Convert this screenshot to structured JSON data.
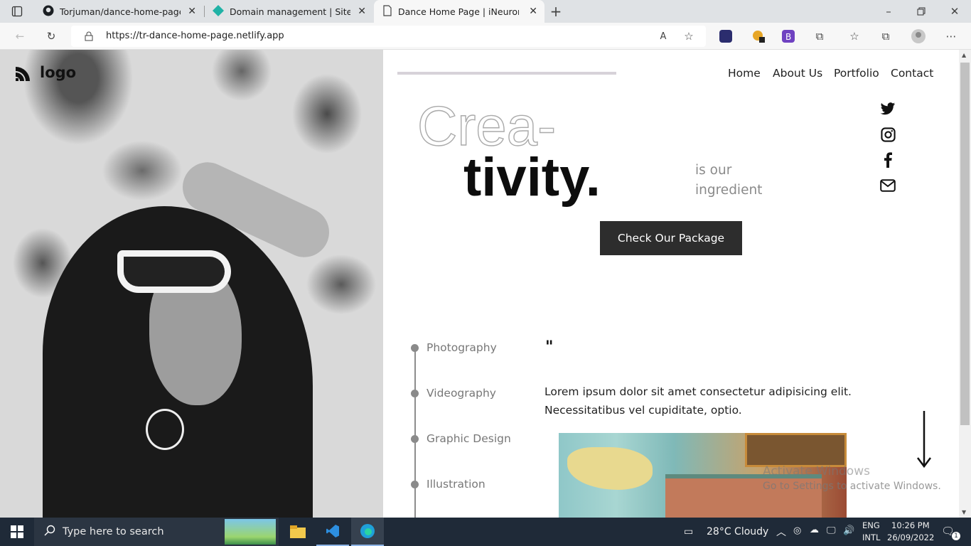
{
  "browser": {
    "tabs": [
      {
        "title": "Torjuman/dance-home-page-iNeuron",
        "icon": "github-icon"
      },
      {
        "title": "Domain management | Site settings",
        "icon": "netlify-icon"
      },
      {
        "title": "Dance Home Page | iNeuron",
        "icon": "page-icon"
      }
    ],
    "url": "https://tr-dance-home-page.netlify.app"
  },
  "site": {
    "logo": "logo",
    "nav": [
      "Home",
      "About Us",
      "Portfolio",
      "Contact"
    ],
    "headline_outline": "Crea-",
    "headline_bold": "tivity.",
    "tagline_line1": "is our",
    "tagline_line2": "ingredient",
    "cta": "Check Our Package",
    "social": [
      "twitter-icon",
      "instagram-icon",
      "facebook-icon",
      "mail-icon"
    ],
    "services": [
      "Photography",
      "Videography",
      "Graphic Design",
      "Illustration"
    ],
    "quote_mark": "\"",
    "lorem": "Lorem ipsum dolor sit amet consectetur adipisicing elit. Necessitatibus vel cupiditate, optio."
  },
  "watermark": {
    "line1": "Activate Windows",
    "line2": "Go to Settings to activate Windows."
  },
  "taskbar": {
    "search_placeholder": "Type here to search",
    "weather": "28°C  Cloudy",
    "lang1": "ENG",
    "lang2": "INTL",
    "time": "10:26 PM",
    "date": "26/09/2022",
    "notifications": "1"
  }
}
